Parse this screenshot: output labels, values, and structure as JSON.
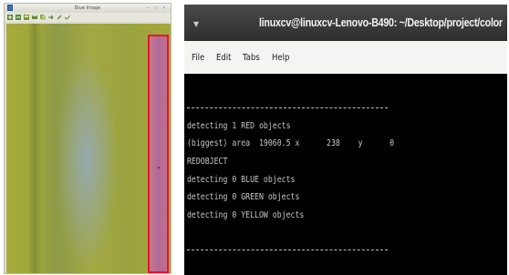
{
  "viewer": {
    "title": "Blue Image",
    "toolbar_icons": [
      "zoom-in-icon",
      "zoom-out-icon",
      "save-icon",
      "print-icon",
      "copy-icon",
      "arrow-icon",
      "pencil-icon",
      "check-icon"
    ],
    "roi_color": "#e2162a"
  },
  "terminal": {
    "title": "linuxcv@linuxcv-Lenovo-B490: ~/Desktop/project/color",
    "menu": [
      "File",
      "Edit",
      "Tabs",
      "Help"
    ],
    "lines": [
      "detecting 1 RED objects",
      "(biggest) area  19060.5 x      238    y      0",
      "REDOBJECT",
      "detecting 0 BLUE objects",
      "detecting 0 GREEN objects",
      "detecting 0 YELLOW objects"
    ]
  }
}
